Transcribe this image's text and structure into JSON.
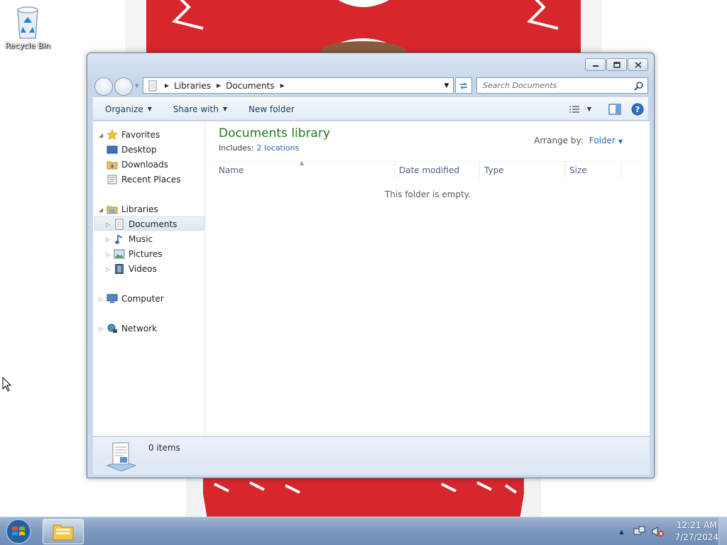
{
  "desktop": {
    "recycle_bin_label": "Recycle Bin"
  },
  "window": {
    "address": {
      "segments": [
        "Libraries",
        "Documents"
      ]
    },
    "search_placeholder": "Search Documents",
    "toolbar": {
      "organize": "Organize",
      "share_with": "Share with",
      "new_folder": "New folder"
    },
    "nav": {
      "favorites": "Favorites",
      "desktop": "Desktop",
      "downloads": "Downloads",
      "recent_places": "Recent Places",
      "libraries": "Libraries",
      "documents": "Documents",
      "music": "Music",
      "pictures": "Pictures",
      "videos": "Videos",
      "computer": "Computer",
      "network": "Network"
    },
    "library": {
      "title": "Documents library",
      "includes_label": "Includes:",
      "locations_link": "2 locations",
      "arrange_label": "Arrange by:",
      "arrange_value": "Folder"
    },
    "columns": [
      "Name",
      "Date modified",
      "Type",
      "Size"
    ],
    "empty_message": "This folder is empty.",
    "details": {
      "item_count": "0 items"
    }
  },
  "taskbar": {
    "time": "12:21 AM",
    "date": "7/27/2024"
  },
  "colors": {
    "library_title": "#1e7a1e",
    "link": "#2a64b8",
    "wallpaper_red": "#d7262c"
  }
}
